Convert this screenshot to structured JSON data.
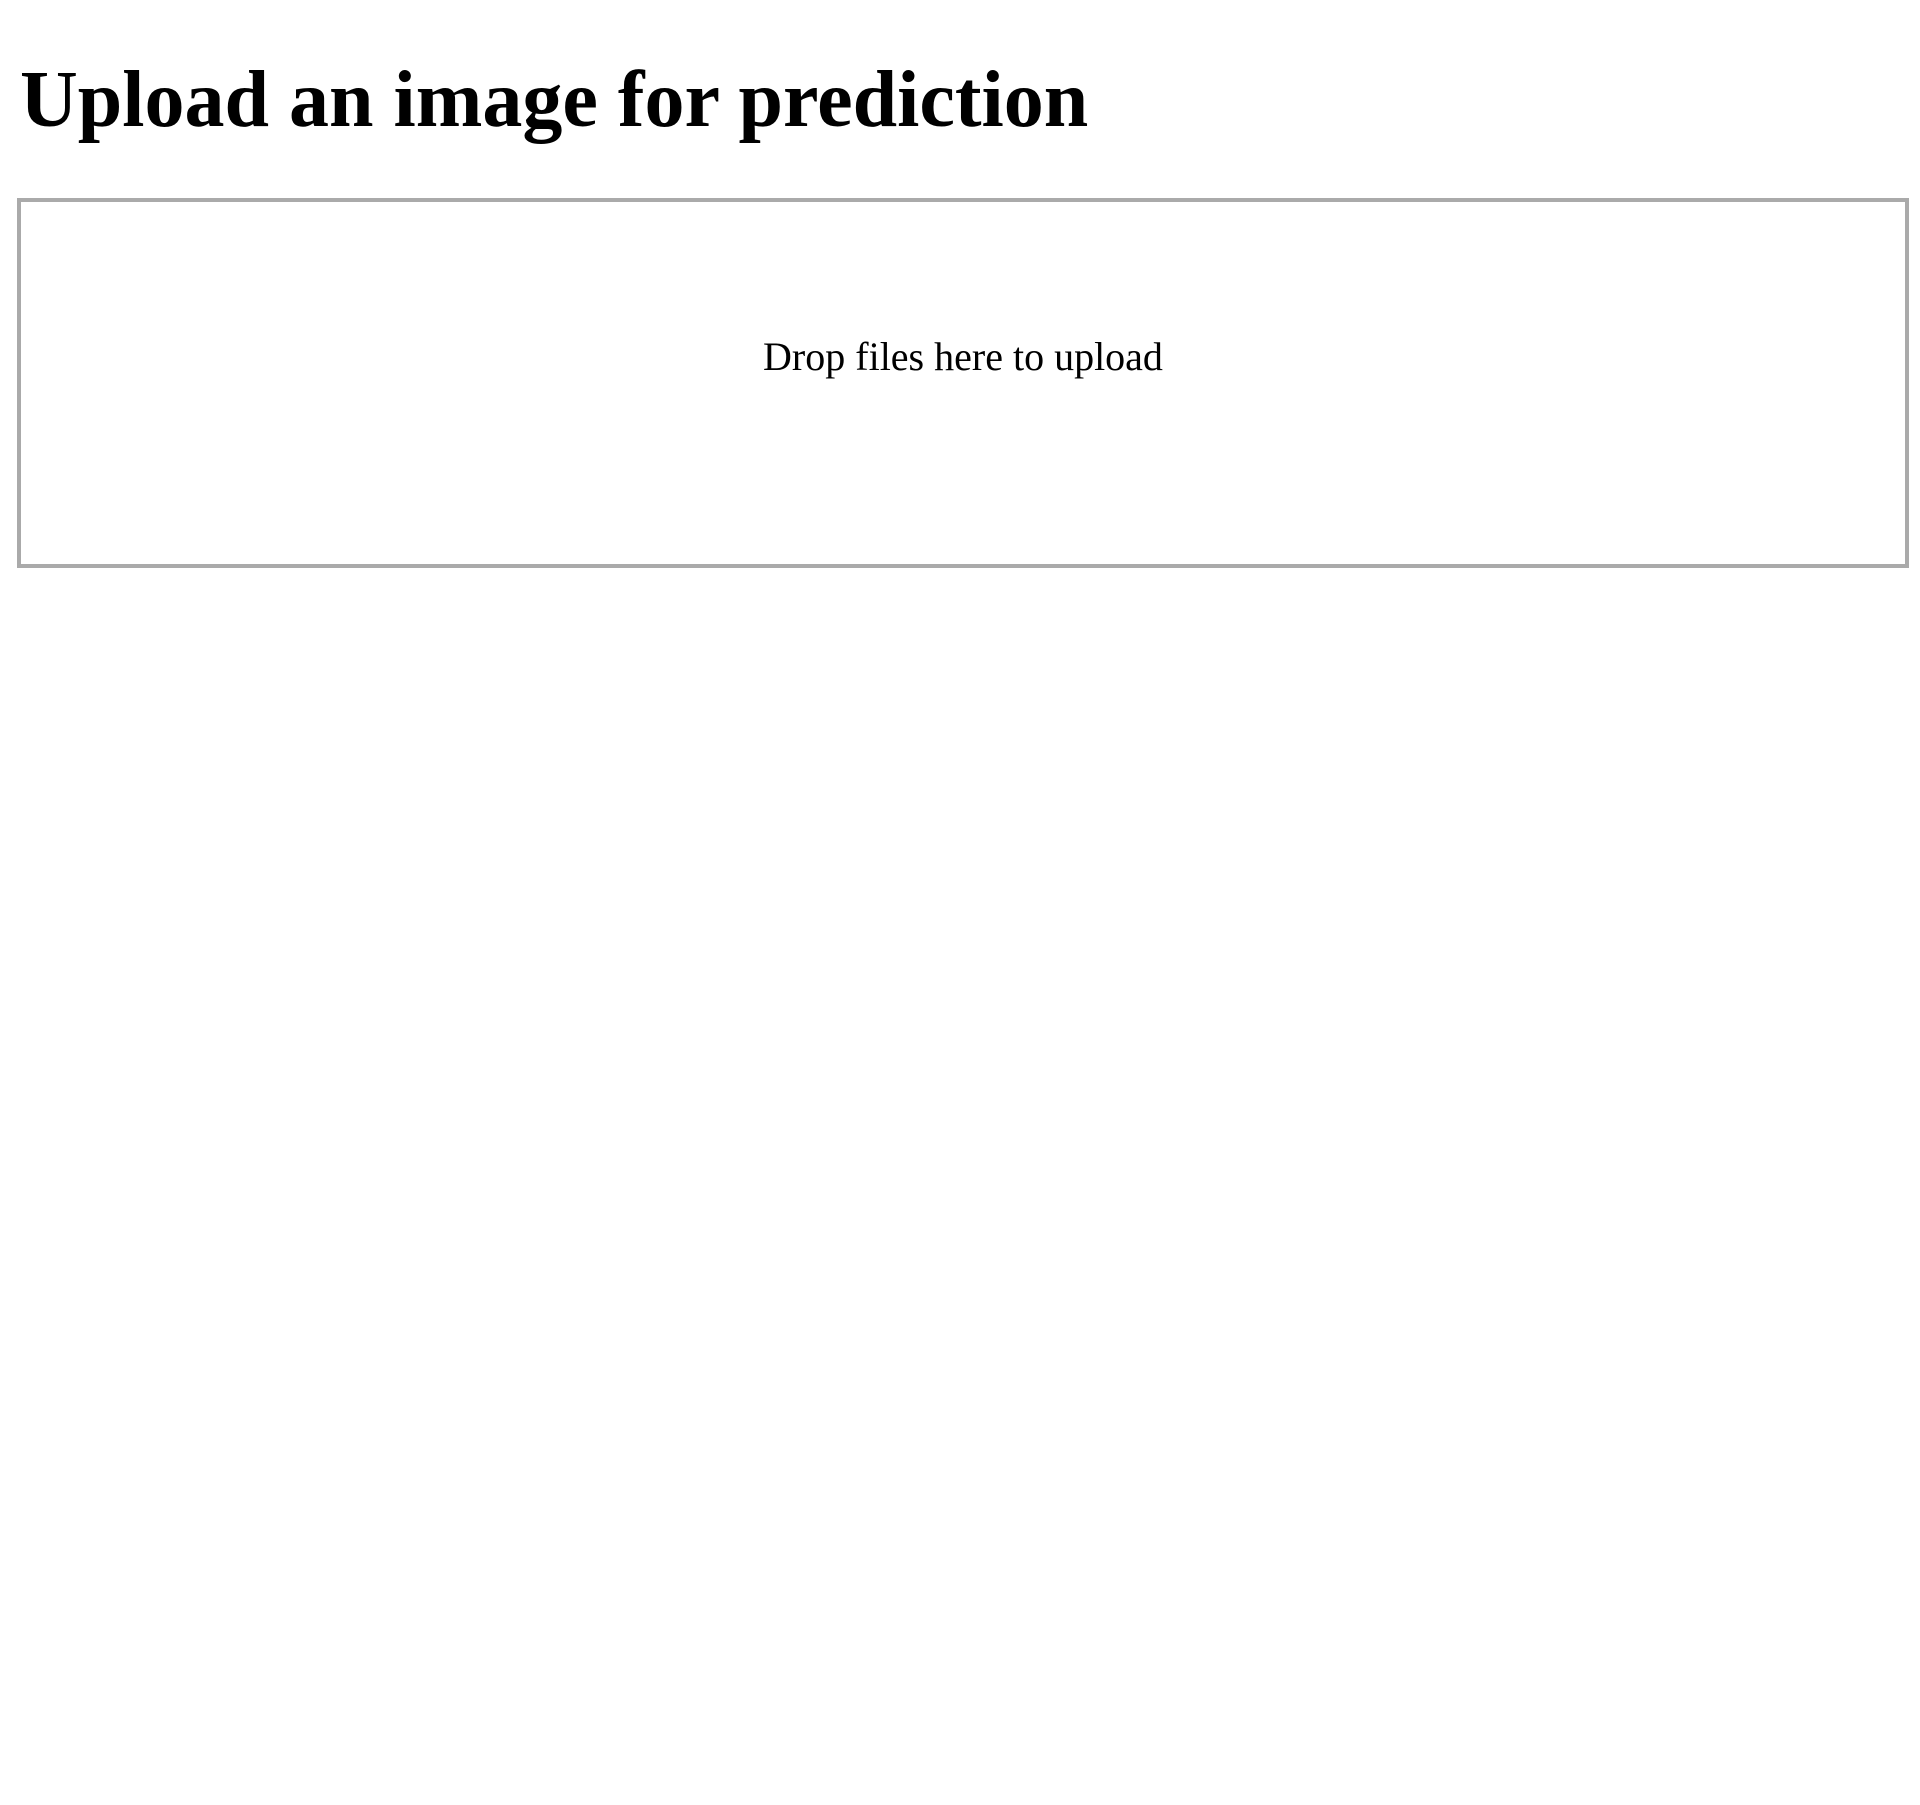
{
  "page": {
    "title": "Upload an image for prediction"
  },
  "dropzone": {
    "message": "Drop files here to upload",
    "border_color": "#aaaaaa"
  }
}
